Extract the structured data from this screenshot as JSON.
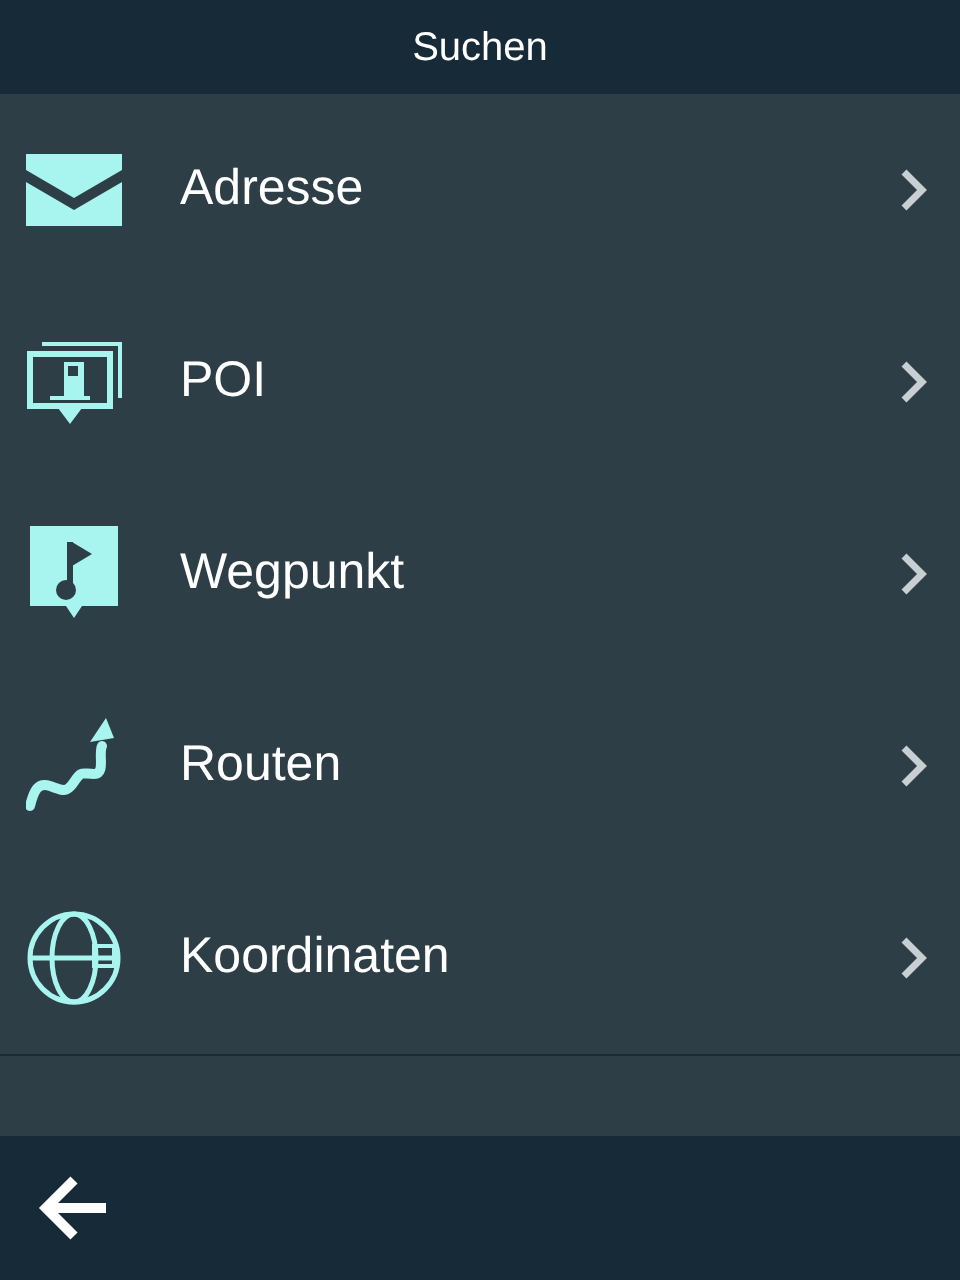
{
  "header": {
    "title": "Suchen"
  },
  "items": [
    {
      "kind": "address",
      "label": "Adresse"
    },
    {
      "kind": "poi",
      "label": "POI"
    },
    {
      "kind": "waypoint",
      "label": "Wegpunkt"
    },
    {
      "kind": "route",
      "label": "Routen"
    },
    {
      "kind": "coordinates",
      "label": "Koordinaten"
    }
  ]
}
